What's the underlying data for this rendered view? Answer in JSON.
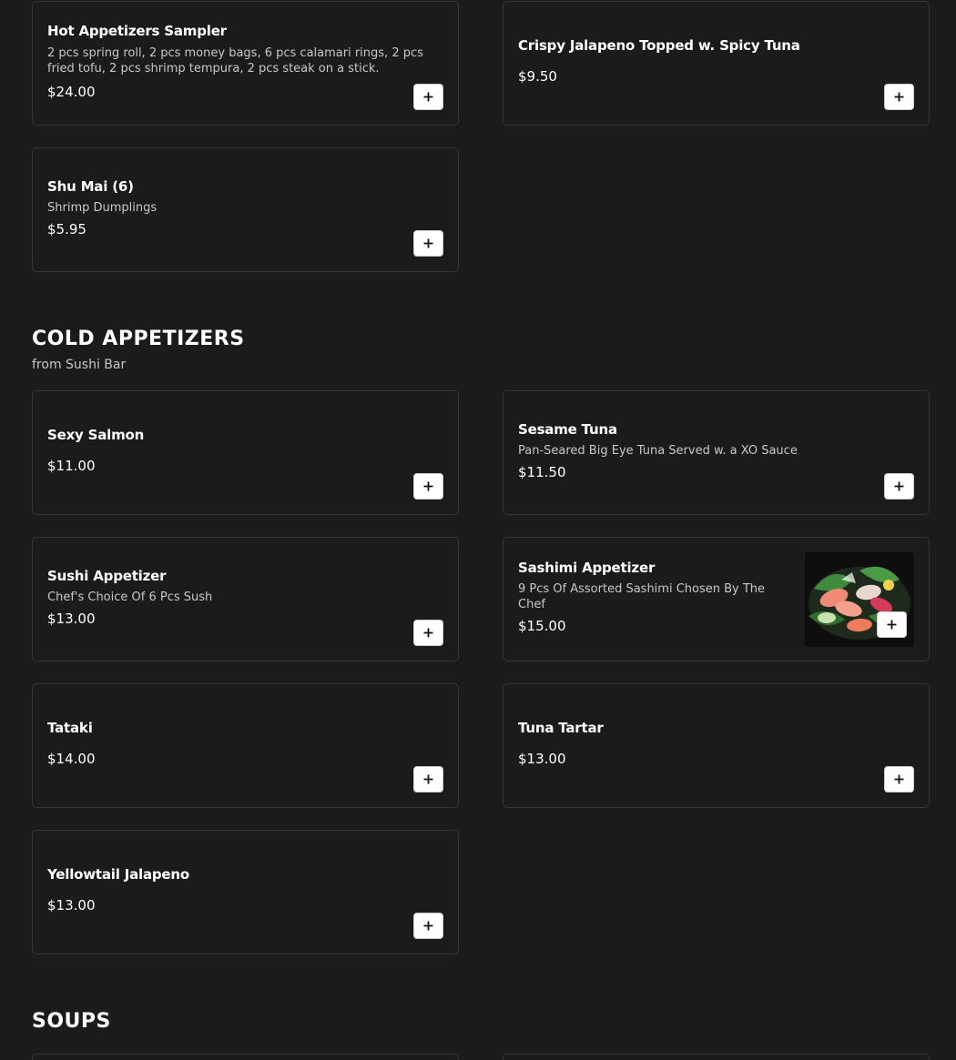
{
  "items_top": [
    {
      "name": "Hot Appetizers Sampler",
      "description": "2 pcs spring roll, 2 pcs money bags, 6 pcs calamari rings, 2 pcs fried tofu, 2 pcs shrimp tempura, 2 pcs steak on a stick.",
      "price": "$24.00"
    },
    {
      "name": "Crispy Jalapeno Topped w. Spicy Tuna",
      "price": "$9.50"
    },
    {
      "name": "Shu Mai (6)",
      "description": "Shrimp Dumplings",
      "price": "$5.95"
    }
  ],
  "cold_section": {
    "title": "COLD APPETIZERS",
    "subtitle": "from Sushi Bar",
    "items": [
      {
        "name": "Sexy Salmon",
        "price": "$11.00"
      },
      {
        "name": "Sesame Tuna",
        "description": "Pan-Seared Big Eye Tuna Served w. a XO Sauce",
        "price": "$11.50"
      },
      {
        "name": "Sushi Appetizer",
        "description": "Chef's Choice Of 6 Pcs Sush",
        "price": "$13.00"
      },
      {
        "name": "Sashimi Appetizer",
        "description": "9 Pcs Of Assorted Sashimi Chosen By The Chef",
        "price": "$15.00"
      },
      {
        "name": "Tataki",
        "price": "$14.00"
      },
      {
        "name": "Tuna Tartar",
        "price": "$13.00"
      },
      {
        "name": "Yellowtail Jalapeno",
        "price": "$13.00"
      }
    ]
  },
  "soups_section": {
    "title": "SOUPS"
  },
  "icons": {
    "add": "plus-icon"
  },
  "colors": {
    "background": "#1b1b1b",
    "card_border": "#353535",
    "text": "#ffffff",
    "muted_text": "#c8c8c8",
    "button_bg": "#ffffff"
  }
}
